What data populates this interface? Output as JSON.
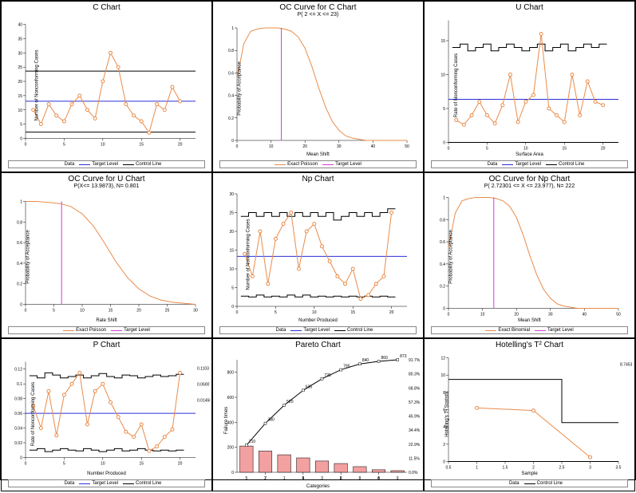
{
  "chart_data": [
    {
      "type": "line",
      "title": "C Chart",
      "xlabel": "",
      "ylabel": "Number of Nonconforming Cases",
      "xlim": [
        0,
        22
      ],
      "ylim": [
        0,
        40
      ],
      "target": 13.04,
      "ucl": 23.6,
      "lcl": 2.2,
      "x": [
        1,
        2,
        3,
        4,
        5,
        6,
        7,
        8,
        9,
        10,
        11,
        12,
        13,
        14,
        15,
        16,
        17,
        18,
        19,
        20
      ],
      "y": [
        10,
        5,
        12,
        8,
        6,
        12,
        15,
        10,
        7,
        20,
        30,
        25,
        12,
        8,
        6,
        2,
        12,
        10,
        18,
        13
      ],
      "legend": [
        {
          "label": "Data",
          "color": "#e98b4a",
          "marker": true
        },
        {
          "label": "Target Level",
          "color": "#2b2fd6"
        },
        {
          "label": "Control Line",
          "color": "#000"
        }
      ]
    },
    {
      "type": "line",
      "title": "OC Curve for C Chart",
      "subtitle": "P( 2 <= X <= 23)",
      "xlabel": "Mean Shift",
      "ylabel": "Probability of Acceptance",
      "xlim": [
        0,
        50
      ],
      "ylim": [
        0,
        1
      ],
      "curve_x": [
        0,
        2,
        4,
        6,
        8,
        10,
        12,
        14,
        16,
        18,
        20,
        22,
        24,
        26,
        28,
        30,
        32,
        34,
        36,
        38,
        40,
        45,
        50
      ],
      "curve_y": [
        0.55,
        0.86,
        0.97,
        0.99,
        1.0,
        1.0,
        1.0,
        0.99,
        0.97,
        0.92,
        0.82,
        0.66,
        0.47,
        0.3,
        0.17,
        0.09,
        0.04,
        0.02,
        0.01,
        0.0,
        0.0,
        0.0,
        0.0
      ],
      "target_x": 13.04,
      "legend": [
        {
          "label": "Exact Poisson",
          "color": "#e98b4a"
        },
        {
          "label": "Target Level",
          "color": "#d63bd6"
        }
      ]
    },
    {
      "type": "line",
      "title": "U Chart",
      "xlabel": "Surface Area",
      "ylabel": "Rate of Nonconforming Cases",
      "xlim": [
        0,
        22
      ],
      "ylim": [
        0,
        18
      ],
      "target": 6.36,
      "ucl_step": [
        14.0,
        14.5,
        13.5,
        14.0,
        14.5,
        13.5,
        14.0,
        14.5,
        14.0,
        13.5,
        14.0,
        14.5,
        13.5,
        14.0,
        14.5,
        13.5,
        14.0,
        14.5,
        14.0,
        14.5
      ],
      "lcl": 0,
      "x": [
        1,
        2,
        3,
        4,
        5,
        6,
        7,
        8,
        9,
        10,
        11,
        12,
        13,
        14,
        15,
        16,
        17,
        18,
        19,
        20
      ],
      "y": [
        3.3,
        2.6,
        4.0,
        6.0,
        4.0,
        2.8,
        5.5,
        10.0,
        3.0,
        6.0,
        7.0,
        16.0,
        5.0,
        4.0,
        3.0,
        10.0,
        4.0,
        9.0,
        6.0,
        5.5
      ],
      "legend": [
        {
          "label": "Data",
          "color": "#e98b4a",
          "marker": true
        },
        {
          "label": "Target Level",
          "color": "#2b2fd6"
        },
        {
          "label": "Control Line",
          "color": "#000"
        }
      ]
    },
    {
      "type": "line",
      "title": "OC Curve for U Chart",
      "subtitle": "P(X<= 13.9873), N= 0.801",
      "xlabel": "Rate Shift",
      "ylabel": "Probability of Acceptance",
      "xlim": [
        0,
        30
      ],
      "ylim": [
        0,
        1
      ],
      "curve_x": [
        0,
        2,
        4,
        6,
        8,
        10,
        12,
        14,
        16,
        18,
        20,
        22,
        24,
        26,
        28,
        30
      ],
      "curve_y": [
        1.0,
        1.0,
        0.99,
        0.98,
        0.95,
        0.88,
        0.76,
        0.59,
        0.41,
        0.26,
        0.15,
        0.08,
        0.04,
        0.02,
        0.01,
        0.0
      ],
      "target_x": 6.36,
      "legend": [
        {
          "label": "Exact Poisson",
          "color": "#e98b4a"
        },
        {
          "label": "Target Level",
          "color": "#d63bd6"
        }
      ]
    },
    {
      "type": "line",
      "title": "Np Chart",
      "xlabel": "Number Produced",
      "ylabel": "Number of Nonconforming Cases",
      "xlim": [
        0,
        22
      ],
      "ylim": [
        0,
        30
      ],
      "target": 13.33,
      "ucl_step": [
        24,
        25,
        24,
        25,
        24,
        25,
        24,
        25,
        24,
        25,
        24,
        25,
        23,
        24,
        25,
        24,
        25,
        24,
        25,
        26
      ],
      "lcl_step": [
        2.7,
        2.5,
        3.0,
        2.5,
        2.7,
        2.5,
        3.0,
        2.5,
        3.0,
        2.5,
        2.7,
        2.5,
        2.7,
        2.5,
        2.7,
        2.5,
        2.7,
        2.5,
        2.7,
        2.5
      ],
      "x": [
        1,
        2,
        3,
        4,
        5,
        6,
        7,
        8,
        9,
        10,
        11,
        12,
        13,
        14,
        15,
        16,
        17,
        18,
        19,
        20
      ],
      "y": [
        14,
        8,
        20,
        6,
        18,
        22,
        25,
        10,
        20,
        22,
        16,
        12,
        8,
        6,
        10,
        2,
        3,
        6,
        8,
        25
      ],
      "legend": [
        {
          "label": "Data",
          "color": "#e98b4a",
          "marker": true
        },
        {
          "label": "Target Level",
          "color": "#2b2fd6"
        },
        {
          "label": "Control Line",
          "color": "#000"
        }
      ]
    },
    {
      "type": "line",
      "title": "OC Curve for Np Chart",
      "subtitle": "P( 2.72301 <= X <= 23.977), N= 222",
      "xlabel": "Mean Shift",
      "ylabel": "Probability of Acceptance",
      "xlim": [
        0,
        50
      ],
      "ylim": [
        0,
        1
      ],
      "curve_x": [
        0,
        2,
        4,
        6,
        8,
        10,
        12,
        14,
        16,
        18,
        20,
        22,
        24,
        26,
        28,
        30,
        32,
        34,
        36,
        38,
        40,
        45,
        50
      ],
      "curve_y": [
        0.55,
        0.86,
        0.97,
        0.99,
        1.0,
        1.0,
        1.0,
        0.99,
        0.97,
        0.92,
        0.82,
        0.66,
        0.47,
        0.3,
        0.17,
        0.09,
        0.04,
        0.02,
        0.01,
        0.0,
        0.0,
        0.0,
        0.0
      ],
      "target_x": 13.33,
      "legend": [
        {
          "label": "Exact Binomial",
          "color": "#e98b4a"
        },
        {
          "label": "Target Level",
          "color": "#d63bd6"
        }
      ]
    },
    {
      "type": "line",
      "title": "P Chart",
      "xlabel": "Number Produced",
      "ylabel": "Rate of Nonconforming Cases",
      "xlim": [
        0,
        22
      ],
      "ylim": [
        0,
        0.13
      ],
      "target": 0.06,
      "ucl_step": [
        0.111,
        0.108,
        0.115,
        0.112,
        0.108,
        0.11,
        0.112,
        0.108,
        0.111,
        0.114,
        0.11,
        0.108,
        0.112,
        0.111,
        0.108,
        0.11,
        0.112,
        0.11,
        0.111,
        0.113
      ],
      "lcl_step": [
        0.01,
        0.012,
        0.008,
        0.01,
        0.012,
        0.01,
        0.009,
        0.012,
        0.01,
        0.008,
        0.01,
        0.012,
        0.009,
        0.01,
        0.012,
        0.01,
        0.009,
        0.01,
        0.009,
        0.01
      ],
      "x": [
        1,
        2,
        3,
        4,
        5,
        6,
        7,
        8,
        9,
        10,
        11,
        12,
        13,
        14,
        15,
        16,
        17,
        18,
        19,
        20
      ],
      "y": [
        0.07,
        0.04,
        0.09,
        0.03,
        0.085,
        0.1,
        0.115,
        0.045,
        0.09,
        0.1,
        0.075,
        0.055,
        0.035,
        0.028,
        0.045,
        0.009,
        0.015,
        0.028,
        0.038,
        0.115
      ],
      "annotations": [
        {
          "x": 7,
          "y": 0.115,
          "text": ""
        },
        {
          "x": 16,
          "y": 0.009,
          "text": ""
        }
      ],
      "legend": [
        {
          "label": "Data",
          "color": "#e98b4a",
          "marker": true
        },
        {
          "label": "Target Level",
          "color": "#2b2fd6"
        },
        {
          "label": "Control Line",
          "color": "#000"
        }
      ],
      "right_labels": [
        "0.1103",
        "0.06007",
        "0.01458"
      ]
    },
    {
      "type": "bar",
      "title": "Pareto Chart",
      "xlabel": "Categories",
      "ylabel": "Failure times",
      "ylabel2": "",
      "xlim": [
        0.5,
        9.5
      ],
      "ylim": [
        0,
        900
      ],
      "ylim2": [
        0,
        100
      ],
      "categories": [
        "5",
        "7",
        "1",
        "6",
        "3",
        "2",
        "8",
        "4",
        "9"
      ],
      "values": [
        210,
        170,
        140,
        115,
        90,
        70,
        45,
        20,
        13
      ],
      "cum_pct": [
        24.0,
        43.5,
        59.6,
        72.8,
        83.1,
        91.1,
        96.3,
        98.6,
        100.0
      ],
      "cum_labels": [
        "210",
        "380",
        "520",
        "635",
        "725",
        "795",
        "840",
        "860",
        "873"
      ],
      "right_ticks": [
        "0.0%",
        "11.5%",
        "22.9%",
        "34.4%",
        "45.9%",
        "57.3%",
        "68.8%",
        "80.3%",
        "91.7%"
      ],
      "legend": []
    },
    {
      "type": "line",
      "title": "Hotelling's T² Chart",
      "xlabel": "Sample",
      "ylabel": "Hotelling's T² Statistic",
      "xlim": [
        0.5,
        3.5
      ],
      "ylim": [
        0,
        12
      ],
      "x": [
        1,
        2,
        3
      ],
      "y": [
        6.2,
        5.9,
        0.5
      ],
      "ucl_step": [
        9.5,
        9.5,
        4.5
      ],
      "lcl": 0,
      "right_labels": [
        "8.7453"
      ],
      "legend": [
        {
          "label": "Data",
          "color": "#e98b4a",
          "marker": true
        },
        {
          "label": "Control Line",
          "color": "#000"
        }
      ]
    }
  ]
}
